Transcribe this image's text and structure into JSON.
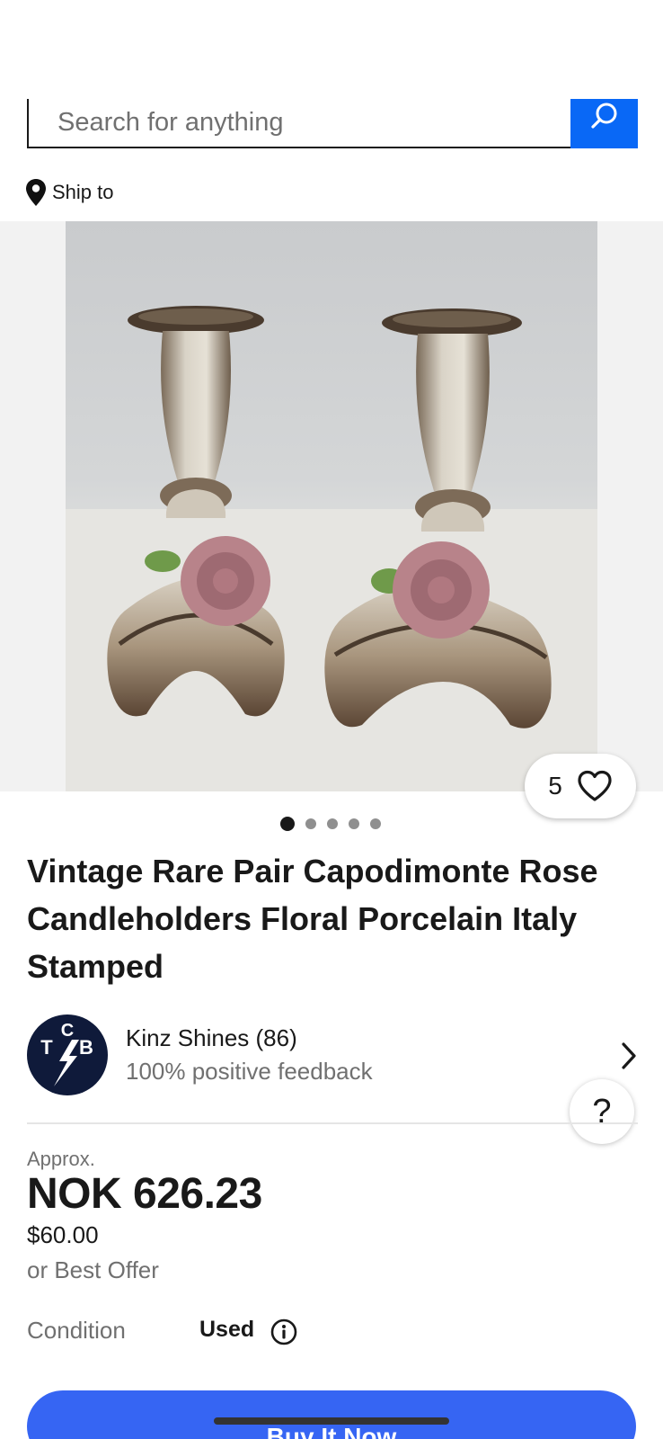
{
  "search": {
    "placeholder": "Search for anything"
  },
  "ship": {
    "label": "Ship to"
  },
  "gallery": {
    "watch_count": "5",
    "image_count": 5,
    "active_index": 0
  },
  "listing": {
    "title": "Vintage Rare Pair Capodimonte Rose Candleholders Floral Porcelain Italy Stamped"
  },
  "seller": {
    "name": "Kinz Shines (86)",
    "feedback": "100% positive feedback"
  },
  "help": {
    "label": "?"
  },
  "price": {
    "approx_label": "Approx.",
    "local": "NOK 626.23",
    "original": "$60.00",
    "offer": "or Best Offer"
  },
  "condition": {
    "label": "Condition",
    "value": "Used"
  },
  "actions": {
    "buy_now": "Buy It Now"
  },
  "colors": {
    "accent": "#3665f3",
    "search_button": "#0968f6",
    "text": "#191919",
    "muted": "#707070"
  }
}
